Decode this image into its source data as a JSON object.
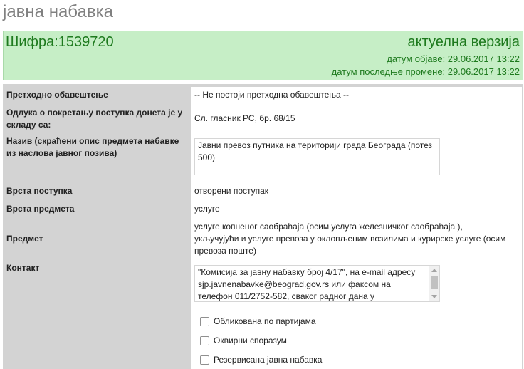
{
  "page": {
    "title": "јавна набавка"
  },
  "header": {
    "code": "Шифра:1539720",
    "version": "актуелна верзија",
    "publish_date": "датум објаве: 29.06.2017 13:22",
    "modified_date": "датум последње промене: 29.06.2017 13:22"
  },
  "fields": {
    "prior_notice": {
      "label": "Претходно обавештење",
      "value": "-- Не постоји претходна обавештења --"
    },
    "decision": {
      "label": "Одлука о покретању поступка донета је у складу са:",
      "value": "Сл. гласник РС, бр. 68/15"
    },
    "name": {
      "label": "Назив (скраћени опис предмета набавке из наслова јавног позива)",
      "value": "Јавни превоз путника на територији града Београда (потез 500)"
    },
    "procedure_type": {
      "label": "Врста поступка",
      "value": "отворени поступак"
    },
    "subject_type": {
      "label": "Врста предмета",
      "value": "услуге"
    },
    "subject": {
      "label": "Предмет",
      "value": "услуге копненог саобраћаја (осим услуга железничког саобраћаја ), укључујући и услуге превоза у оклопљеним возилима и курирске услуге (осим превоза поште)"
    },
    "contact": {
      "label": "Контакт",
      "value": "\"Комисија за јавну набавку број 4/17\", на e-mail адресу sjp.javnenabavke@beograd.gov.rs или факсом на телефон 011/2752-582, сваког радног дана у"
    }
  },
  "checkboxes": [
    {
      "label": "Обликована по партијама",
      "checked": false
    },
    {
      "label": "Оквирни споразум",
      "checked": false
    },
    {
      "label": "Резервисана јавна набавка",
      "checked": false
    }
  ]
}
